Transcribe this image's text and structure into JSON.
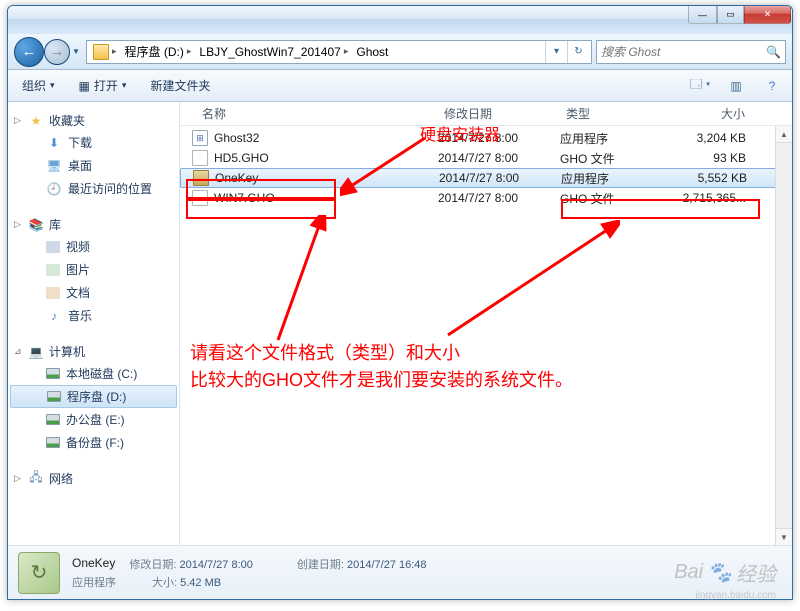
{
  "breadcrumb": {
    "seg1": "程序盘 (D:)",
    "seg2": "LBJY_GhostWin7_201407",
    "seg3": "Ghost"
  },
  "search": {
    "placeholder": "搜索 Ghost"
  },
  "toolbar": {
    "organize": "组织",
    "open": "打开",
    "newfolder": "新建文件夹"
  },
  "sidebar": {
    "favorites": "收藏夹",
    "downloads": "下载",
    "desktop": "桌面",
    "recent": "最近访问的位置",
    "libraries": "库",
    "videos": "视频",
    "pictures": "图片",
    "documents": "文档",
    "music": "音乐",
    "computer": "计算机",
    "disk_c": "本地磁盘 (C:)",
    "disk_d": "程序盘 (D:)",
    "disk_e": "办公盘 (E:)",
    "disk_f": "备份盘 (F:)",
    "network": "网络"
  },
  "columns": {
    "name": "名称",
    "date": "修改日期",
    "type": "类型",
    "size": "大小"
  },
  "files": [
    {
      "name": "Ghost32",
      "date": "2014/7/27 8:00",
      "type": "应用程序",
      "size": "3,204 KB"
    },
    {
      "name": "HD5.GHO",
      "date": "2014/7/27 8:00",
      "type": "GHO 文件",
      "size": "93 KB"
    },
    {
      "name": "OneKey",
      "date": "2014/7/27 8:00",
      "type": "应用程序",
      "size": "5,552 KB"
    },
    {
      "name": "WIN7.GHO",
      "date": "2014/7/27 8:00",
      "type": "GHO 文件",
      "size": "2,715,365..."
    }
  ],
  "annotations": {
    "label1": "硬盘安装器",
    "line1": "请看这个文件格式（类型）和大小",
    "line2": "比较大的GHO文件才是我们要安装的系统文件。"
  },
  "details": {
    "name": "OneKey",
    "date_label": "修改日期:",
    "date": "2014/7/27 8:00",
    "created_label": "创建日期:",
    "created": "2014/7/27 16:48",
    "type": "应用程序",
    "size_label": "大小:",
    "size": "5.42 MB"
  },
  "watermark": {
    "brand": "Bai",
    "brand2": "经验",
    "sub": "jingyan.baidu.com"
  }
}
